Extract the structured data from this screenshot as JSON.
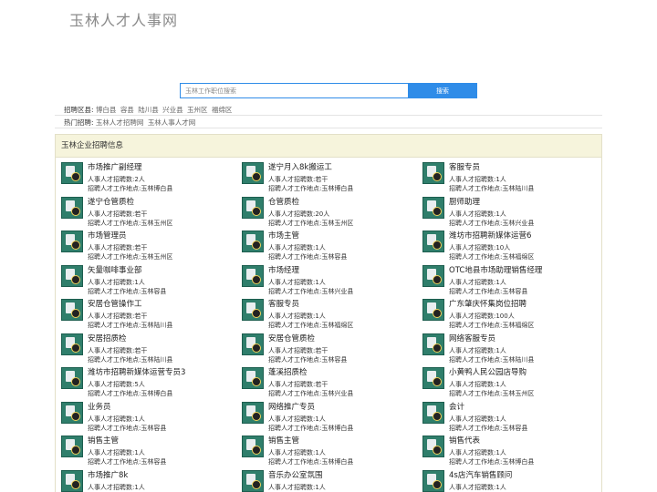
{
  "site": {
    "logo_text": "玉林人才人事网"
  },
  "search": {
    "placeholder": "玉林工作职位搜索",
    "button_label": "搜索"
  },
  "regions": {
    "label": "招聘区县:",
    "items": [
      "博白县",
      "容县",
      "陆川县",
      "兴业县",
      "玉州区",
      "福绵区"
    ]
  },
  "hot": {
    "label": "热门招聘:",
    "items": [
      "玉林人才招聘网",
      "玉林人事人才网"
    ]
  },
  "panel": {
    "title": "玉林企业招聘信息"
  },
  "jobs": [
    {
      "title": "市场推广副经理",
      "count": "人事人才招聘数:2人",
      "location": "招聘人才工作地点:玉林博白县"
    },
    {
      "title": "遂宁月入8k搬运工",
      "count": "人事人才招聘数:若干",
      "location": "招聘人才工作地点:玉林博白县"
    },
    {
      "title": "客服专员",
      "count": "人事人才招聘数:1人",
      "location": "招聘人才工作地点:玉林陆川县"
    },
    {
      "title": "遂宁仓管质检",
      "count": "人事人才招聘数:若干",
      "location": "招聘人才工作地点:玉林玉州区"
    },
    {
      "title": "仓管质检",
      "count": "人事人才招聘数:20人",
      "location": "招聘人才工作地点:玉林玉州区"
    },
    {
      "title": "厨师助理",
      "count": "人事人才招聘数:1人",
      "location": "招聘人才工作地点:玉林兴业县"
    },
    {
      "title": "市场管理员",
      "count": "人事人才招聘数:若干",
      "location": "招聘人才工作地点:玉林玉州区"
    },
    {
      "title": "市场主管",
      "count": "人事人才招聘数:1人",
      "location": "招聘人才工作地点:玉林容县"
    },
    {
      "title": "潍坊市招聘新媒体运营6",
      "count": "人事人才招聘数:10人",
      "location": "招聘人才工作地点:玉林福绵区"
    },
    {
      "title": "矢量咖啡事业部",
      "count": "人事人才招聘数:1人",
      "location": "招聘人才工作地点:玉林容县"
    },
    {
      "title": "市场经理",
      "count": "人事人才招聘数:1人",
      "location": "招聘人才工作地点:玉林兴业县"
    },
    {
      "title": "OTC地县市场助理销售经理",
      "count": "人事人才招聘数:1人",
      "location": "招聘人才工作地点:玉林容县"
    },
    {
      "title": "安居仓管操作工",
      "count": "人事人才招聘数:若干",
      "location": "招聘人才工作地点:玉林陆川县"
    },
    {
      "title": "客服专员",
      "count": "人事人才招聘数:1人",
      "location": "招聘人才工作地点:玉林福绵区"
    },
    {
      "title": "广东肇庆怀集岗位招聘",
      "count": "人事人才招聘数:100人",
      "location": "招聘人才工作地点:玉林福绵区"
    },
    {
      "title": "安居招质检",
      "count": "人事人才招聘数:若干",
      "location": "招聘人才工作地点:玉林陆川县"
    },
    {
      "title": "安居仓管质检",
      "count": "人事人才招聘数:若干",
      "location": "招聘人才工作地点:玉林容县"
    },
    {
      "title": "网络客服专员",
      "count": "人事人才招聘数:1人",
      "location": "招聘人才工作地点:玉林陆川县"
    },
    {
      "title": "潍坊市招聘新媒体运营专员3",
      "count": "人事人才招聘数:5人",
      "location": "招聘人才工作地点:玉林博白县"
    },
    {
      "title": "蓬溪招质检",
      "count": "人事人才招聘数:若干",
      "location": "招聘人才工作地点:玉林兴业县"
    },
    {
      "title": "小黄鸭人民公园店导购",
      "count": "人事人才招聘数:1人",
      "location": "招聘人才工作地点:玉林玉州区"
    },
    {
      "title": "业务员",
      "count": "人事人才招聘数:1人",
      "location": "招聘人才工作地点:玉林容县"
    },
    {
      "title": "网络推广专员",
      "count": "人事人才招聘数:1人",
      "location": "招聘人才工作地点:玉林博白县"
    },
    {
      "title": "会计",
      "count": "人事人才招聘数:1人",
      "location": "招聘人才工作地点:玉林容县"
    },
    {
      "title": "销售主管",
      "count": "人事人才招聘数:1人",
      "location": "招聘人才工作地点:玉林容县"
    },
    {
      "title": "销售主管",
      "count": "人事人才招聘数:1人",
      "location": "招聘人才工作地点:玉林博白县"
    },
    {
      "title": "销售代表",
      "count": "人事人才招聘数:1人",
      "location": "招聘人才工作地点:玉林博白县"
    },
    {
      "title": "市场推广8k",
      "count": "人事人才招聘数:1人",
      "location": ""
    },
    {
      "title": "音乐办公室氛围",
      "count": "人事人才招聘数:1人",
      "location": ""
    },
    {
      "title": "4s店汽车销售顾问",
      "count": "人事人才招聘数:1人",
      "location": ""
    }
  ]
}
